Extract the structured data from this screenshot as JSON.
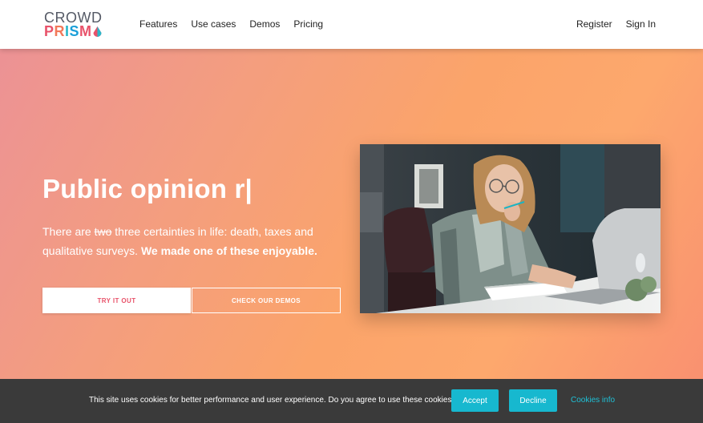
{
  "header": {
    "logo_top": "CROWD",
    "logo_bottom_letters": [
      {
        "char": "P",
        "color": "#e8526a"
      },
      {
        "char": "R",
        "color": "#f2795a"
      },
      {
        "char": "I",
        "color": "#2ab7c9"
      },
      {
        "char": "S",
        "color": "#1a9fd9"
      },
      {
        "char": "M",
        "color": "#e8526a"
      }
    ],
    "nav": [
      "Features",
      "Use cases",
      "Demos",
      "Pricing"
    ],
    "register_label": "Register",
    "signin_label": "Sign In"
  },
  "hero": {
    "title": "Public opinion r|",
    "text_before": "There are ",
    "text_strike": "two",
    "text_after": " three certainties in life: death, taxes and qualitative surveys. ",
    "text_bold": "We made one of these enjoyable.",
    "try_label": "TRY IT OUT",
    "demos_label": "CHECK OUR DEMOS"
  },
  "cookie": {
    "text": "This site uses cookies for better performance and user experience. Do you agree to use these cookies?",
    "accept_label": "Accept",
    "decline_label": "Decline",
    "info_label": "Cookies info"
  },
  "colors": {
    "accent": "#17b8cf",
    "brand_red": "#e8526a"
  }
}
